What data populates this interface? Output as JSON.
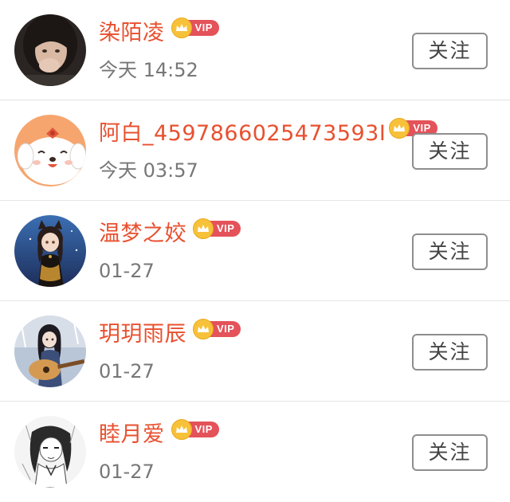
{
  "users": [
    {
      "name": "染陌凌",
      "time": "今天 14:52",
      "badge": "VIP",
      "follow_label": "关注",
      "avatar": "photo-girl-avatar"
    },
    {
      "name": "阿白_4597866025473593I",
      "time": "今天 03:57",
      "badge": "VIP",
      "follow_label": "关注",
      "avatar": "cartoon-dog-avatar"
    },
    {
      "name": "温梦之姣",
      "time": "01-27",
      "badge": "VIP",
      "follow_label": "关注",
      "avatar": "anime-catgirl-avatar"
    },
    {
      "name": "玥玥雨辰",
      "time": "01-27",
      "badge": "VIP",
      "follow_label": "关注",
      "avatar": "anime-guitar-girl-avatar"
    },
    {
      "name": "睦月爱",
      "time": "01-27",
      "badge": "VIP",
      "follow_label": "关注",
      "avatar": "manga-sketch-avatar"
    }
  ],
  "colors": {
    "name": "#e8502f",
    "time": "#777777",
    "vip_pill": "#e4525a",
    "vip_crown": "#f7c23a",
    "button_border": "#8e8e8e"
  }
}
